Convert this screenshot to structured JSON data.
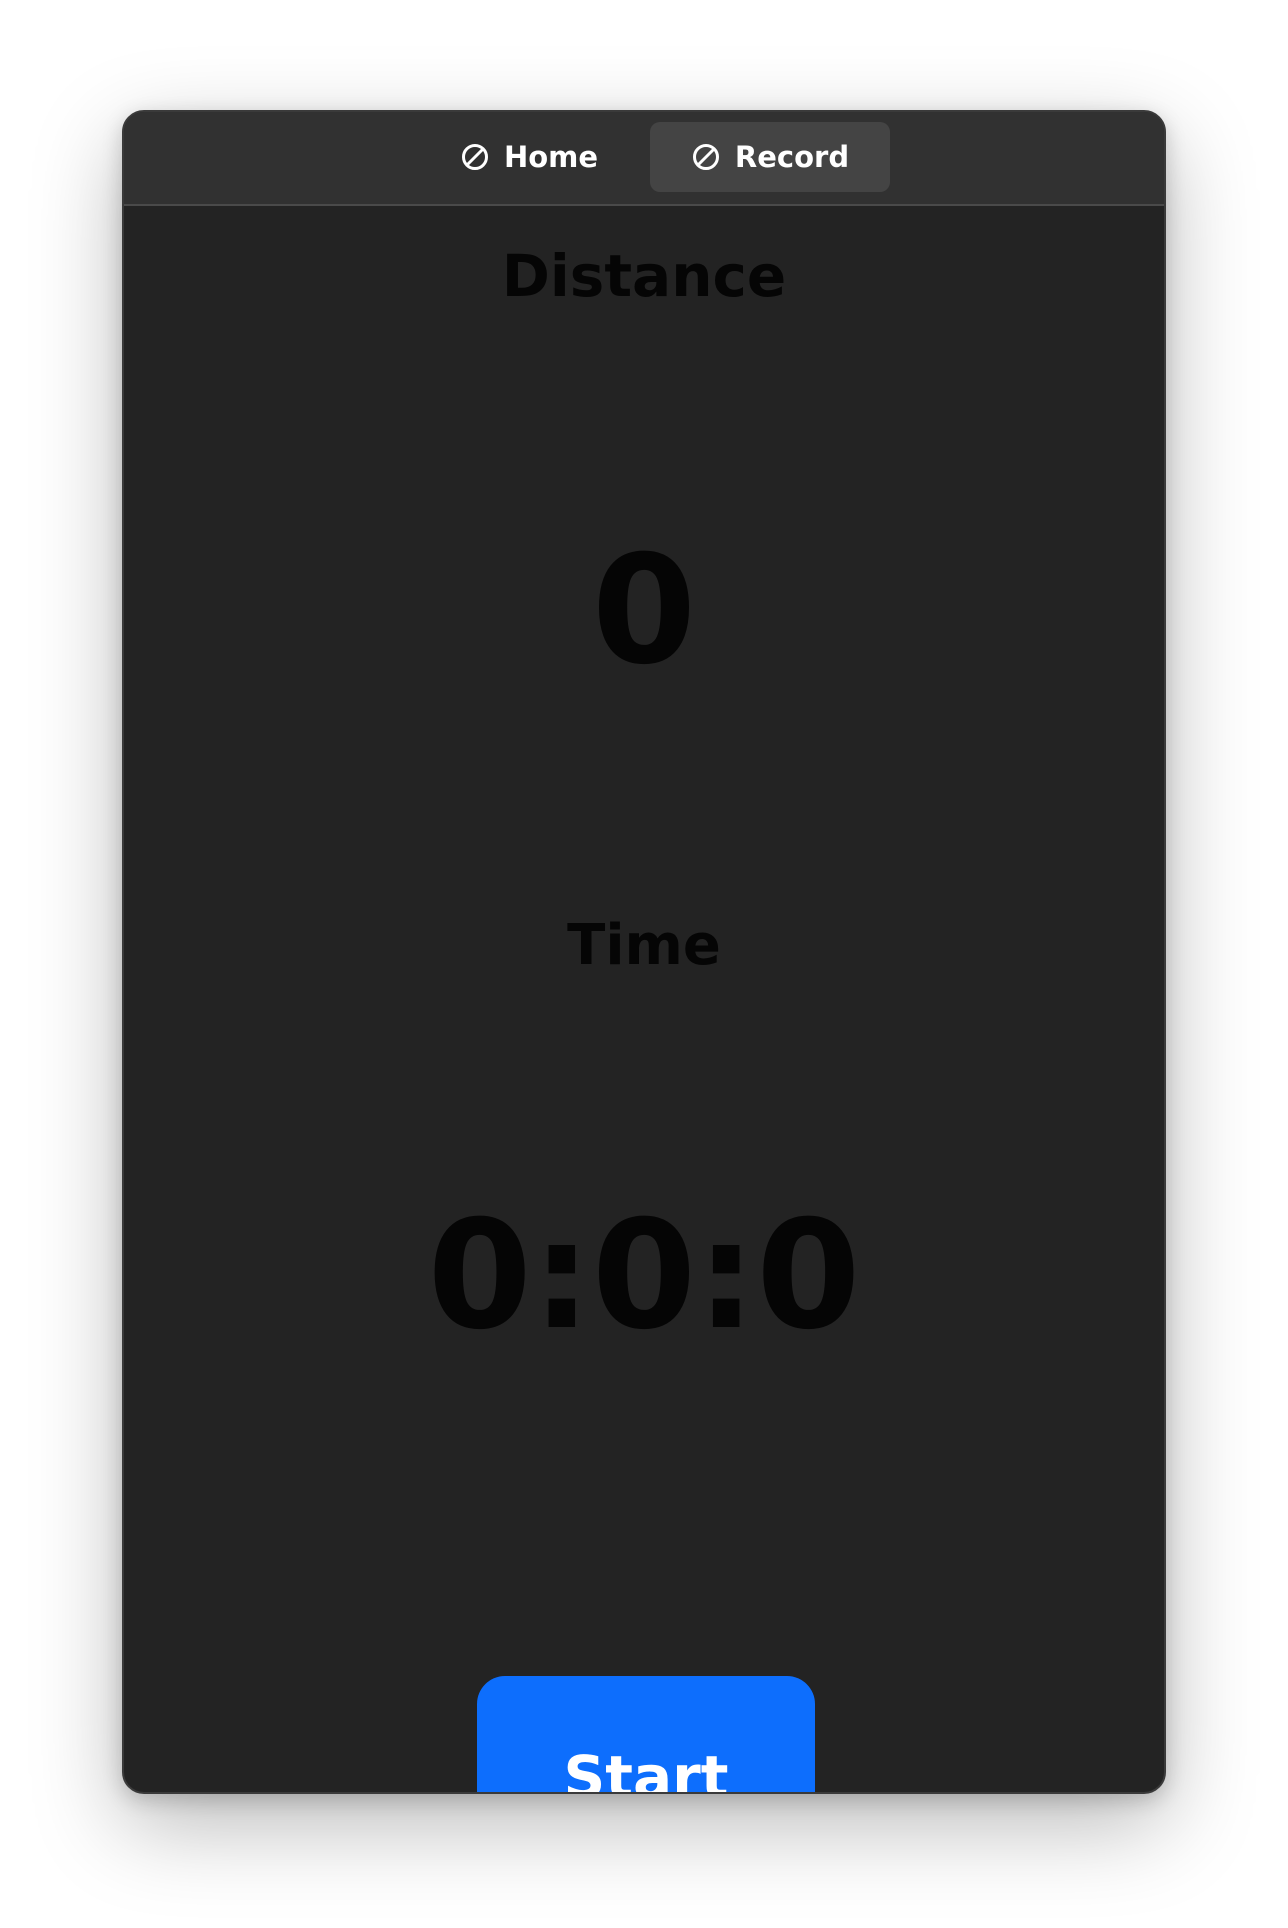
{
  "nav": {
    "tabs": [
      {
        "label": "Home",
        "icon": "ban-icon",
        "active": false
      },
      {
        "label": "Record",
        "icon": "ban-icon",
        "active": true
      }
    ]
  },
  "main": {
    "distance_label": "Distance",
    "distance_value": "0",
    "time_label": "Time",
    "time_value": "0:0:0",
    "start_label": "Start"
  },
  "colors": {
    "background": "#232323",
    "tabbar": "#313131",
    "active_tab": "#444444",
    "accent": "#0d6efd",
    "value_text": "#050505"
  }
}
